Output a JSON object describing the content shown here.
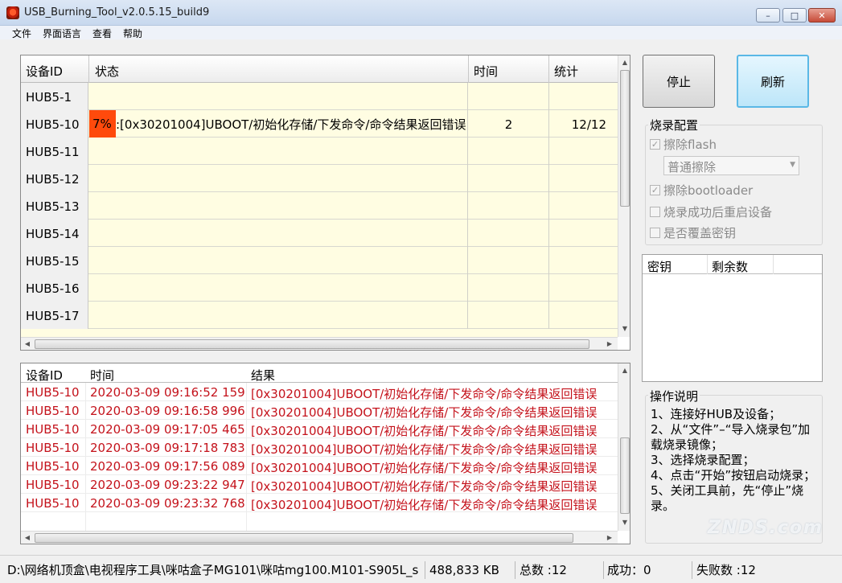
{
  "window": {
    "title": "USB_Burning_Tool_v2.0.5.15_build9",
    "min": "–",
    "max": "□",
    "close": "✕"
  },
  "menu": [
    "文件",
    "界面语言",
    "查看",
    "帮助"
  ],
  "device_grid": {
    "headers": [
      "设备ID",
      "状态",
      "时间",
      "统计"
    ],
    "rows": [
      {
        "id": "HUB5-1",
        "status": "",
        "time": "",
        "stats": ""
      },
      {
        "id": "HUB5-10",
        "progress_label": "7%",
        "progress": 0.07,
        "status": ":[0x30201004]UBOOT/初始化存储/下发命令/命令结果返回错误",
        "time": "2",
        "stats": "12/12"
      },
      {
        "id": "HUB5-11",
        "status": "",
        "time": "",
        "stats": ""
      },
      {
        "id": "HUB5-12",
        "status": "",
        "time": "",
        "stats": ""
      },
      {
        "id": "HUB5-13",
        "status": "",
        "time": "",
        "stats": ""
      },
      {
        "id": "HUB5-14",
        "status": "",
        "time": "",
        "stats": ""
      },
      {
        "id": "HUB5-15",
        "status": "",
        "time": "",
        "stats": ""
      },
      {
        "id": "HUB5-16",
        "status": "",
        "time": "",
        "stats": ""
      },
      {
        "id": "HUB5-17",
        "status": "",
        "time": "",
        "stats": ""
      }
    ]
  },
  "log_grid": {
    "headers": [
      "设备ID",
      "时间",
      "结果"
    ],
    "rows": [
      {
        "id": "HUB5-10",
        "time": "2020-03-09 09:16:52 159",
        "result": "[0x30201004]UBOOT/初始化存储/下发命令/命令结果返回错误"
      },
      {
        "id": "HUB5-10",
        "time": "2020-03-09 09:16:58 996",
        "result": "[0x30201004]UBOOT/初始化存储/下发命令/命令结果返回错误"
      },
      {
        "id": "HUB5-10",
        "time": "2020-03-09 09:17:05 465",
        "result": "[0x30201004]UBOOT/初始化存储/下发命令/命令结果返回错误"
      },
      {
        "id": "HUB5-10",
        "time": "2020-03-09 09:17:18 783",
        "result": "[0x30201004]UBOOT/初始化存储/下发命令/命令结果返回错误"
      },
      {
        "id": "HUB5-10",
        "time": "2020-03-09 09:17:56 089",
        "result": "[0x30201004]UBOOT/初始化存储/下发命令/命令结果返回错误"
      },
      {
        "id": "HUB5-10",
        "time": "2020-03-09 09:23:22 947",
        "result": "[0x30201004]UBOOT/初始化存储/下发命令/命令结果返回错误"
      },
      {
        "id": "HUB5-10",
        "time": "2020-03-09 09:23:32 768",
        "result": "[0x30201004]UBOOT/初始化存储/下发命令/命令结果返回错误"
      }
    ]
  },
  "buttons": {
    "stop": "停止",
    "refresh": "刷新"
  },
  "burn_config": {
    "title": "烧录配置",
    "erase_flash": "擦除flash",
    "erase_mode": "普通擦除",
    "erase_bootloader": "擦除bootloader",
    "reboot_after": "烧录成功后重启设备",
    "overwrite_key": "是否覆盖密钥"
  },
  "key_table": {
    "headers": [
      "密钥",
      "剩余数"
    ]
  },
  "instructions": {
    "title": "操作说明",
    "text": "1、连接好HUB及设备；\n2、从“文件”–“导入烧录包”加载烧录镜像；\n3、选择烧录配置；\n4、点击“开始”按钮启动烧录；\n5、关闭工具前，先“停止”烧录。"
  },
  "status_bar": {
    "path": "D:\\网络机顶盒\\电视程序工具\\咪咕盒子MG101\\咪咕mg100.M101-S905L_s",
    "size": "488,833 KB",
    "total": "总数 :12",
    "success": "成功：0",
    "failed": "失败数 :12"
  },
  "watermark": "ZNDS.com",
  "colors": {
    "grid_bg": "#fffde2",
    "log_text": "#c4121b",
    "progress": "#ff4a0c",
    "refresh_bg": "#cfeefc"
  }
}
